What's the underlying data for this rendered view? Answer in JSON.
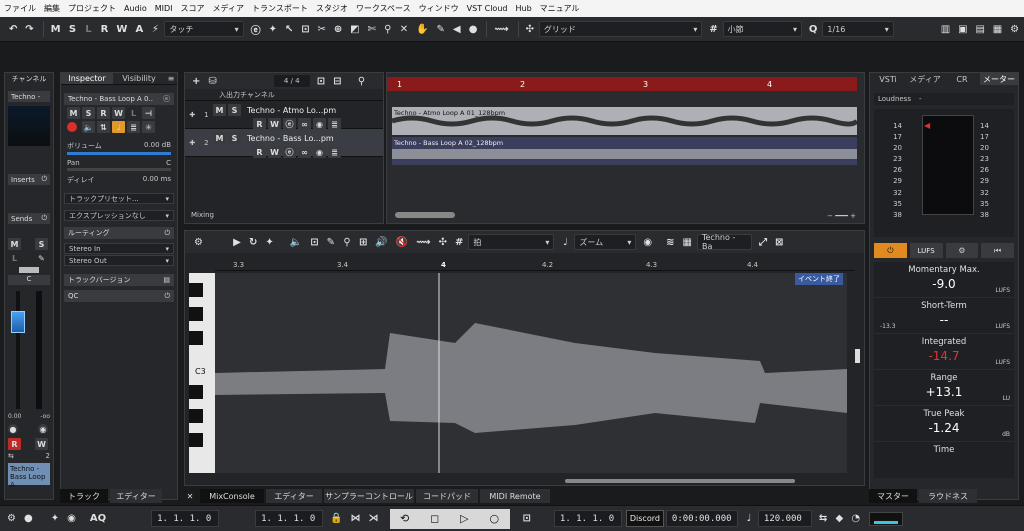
{
  "menu": [
    "ファイル",
    "編集",
    "プロジェクト",
    "Audio",
    "MIDI",
    "スコア",
    "メディア",
    "トランスポート",
    "スタジオ",
    "ワークスペース",
    "ウィンドウ",
    "VST Cloud",
    "Hub",
    "マニュアル"
  ],
  "toolbar": {
    "letters": [
      "M",
      "S",
      "L",
      "R",
      "W",
      "A"
    ],
    "touch_mode": "タッチ",
    "snap_type": "グリッド",
    "grid_label": "小節",
    "quantize": "1/16"
  },
  "channel_panel": {
    "tab": "チャンネル",
    "track_name": "Techno -",
    "inserts": "Inserts",
    "sends": "Sends",
    "fader_value": "0.00",
    "c_label": "C",
    "num": "2",
    "footer": "Techno - Bass Loop A",
    "dash": "-oo"
  },
  "inspector": {
    "tab_inspector": "Inspector",
    "tab_visibility": "Visibility",
    "track_title": "Techno - Bass Loop A 0..",
    "volume_label": "ボリューム",
    "volume_value": "0.00 dB",
    "pan_label": "Pan",
    "pan_value": "C",
    "delay_label": "ディレイ",
    "delay_value": "0.00 ms",
    "preset": "トラックプリセット...",
    "expansion": "エクスプレッションなし",
    "routing": "ルーティング",
    "input": "Stereo In",
    "output": "Stereo Out",
    "track_versions": "トラックバージョン",
    "qc": "QC"
  },
  "tracklist": {
    "count": "4 / 4",
    "folder": "入出力チャンネル",
    "tracks": [
      {
        "num": "1",
        "name": "Techno - Atmo Lo...pm"
      },
      {
        "num": "2",
        "name": "Techno - Bass Lo...pm"
      }
    ],
    "mixing": "Mixing"
  },
  "arrange": {
    "ruler": [
      "1",
      "2",
      "3",
      "4"
    ],
    "events": [
      "Techno - Atmo Loop A 01_128bpm",
      "Techno - Bass Loop A 02_128bpm"
    ]
  },
  "editor": {
    "quant_label": "拍",
    "zoom_label": "ズーム",
    "track_field": "Techno - Ba",
    "ruler": [
      "3.3",
      "3.4",
      "4",
      "4.2",
      "4.3",
      "4.4"
    ],
    "event_end": "イベント終了",
    "c3": "C3"
  },
  "bottom_tabs": [
    "トラック",
    "エディター",
    "MixConsole",
    "エディター",
    "サンプラーコントロール",
    "コードパッド",
    "MIDI Remote"
  ],
  "right_panel": {
    "tabs": [
      "VSTi",
      "メディア",
      "CR",
      "メーター"
    ],
    "loudness": "Loudness",
    "loudness_dash": "-",
    "scale": [
      "14",
      "17",
      "20",
      "23",
      "26",
      "29",
      "32",
      "35",
      "38"
    ],
    "lufs_btn": "LUFS",
    "momentary": {
      "label": "Momentary Max.",
      "value": "-9.0",
      "unit": "LUFS"
    },
    "short_term": {
      "label": "Short-Term",
      "value": "--",
      "left": "-13.3",
      "unit": "LUFS"
    },
    "integrated": {
      "label": "Integrated",
      "value": "-14.7",
      "unit": "LUFS"
    },
    "range": {
      "label": "Range",
      "value": "+13.1",
      "unit": "LU"
    },
    "true_peak": {
      "label": "True Peak",
      "value": "-1.24",
      "unit": "dB"
    },
    "time": {
      "label": "Time"
    },
    "footer_tabs": [
      "マスター",
      "ラウドネス"
    ]
  },
  "transport": {
    "pos1": "1. 1. 1. 0",
    "pos2": "1. 1. 1. 0",
    "pos3": "1. 1. 1. 0",
    "time": "0:00:00.000",
    "tempo": "120.000",
    "tooltip": "Discord",
    "aq": "AQ"
  },
  "colors": {
    "accent_red": "#d9302c",
    "orange": "#e09a2c",
    "blue": "#2d7dd2",
    "ruler_red": "#8b1a1a"
  }
}
